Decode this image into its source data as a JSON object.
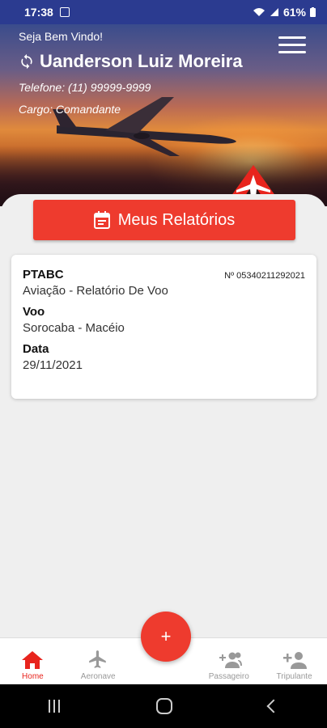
{
  "status_bar": {
    "time": "17:38",
    "battery": "61%"
  },
  "header": {
    "greeting": "Seja Bem Vindo!",
    "user_name": "Uanderson Luiz Moreira",
    "phone": "Telefone: (11) 99999-9999",
    "role": "Cargo: Comandante"
  },
  "reports_button": {
    "label": "Meus Relatórios"
  },
  "report": {
    "aircraft": "PTABC",
    "number": "Nº 05340211292021",
    "type": "Aviação - Relatório De Voo",
    "flight_label": "Voo",
    "flight_route": "Sorocaba - Macéio",
    "date_label": "Data",
    "date_value": "29/11/2021"
  },
  "fab": {
    "label": "+"
  },
  "bottom_nav": {
    "items": [
      {
        "label": "Home",
        "icon": "home-icon",
        "active": true
      },
      {
        "label": "Aeronave",
        "icon": "airplane-icon",
        "active": false
      },
      {
        "label": "Passageiro",
        "icon": "group-add-icon",
        "active": false
      },
      {
        "label": "Tripulante",
        "icon": "person-add-icon",
        "active": false
      }
    ]
  },
  "colors": {
    "primary": "#ee3b2e",
    "status_bar": "#2b3b90",
    "active_nav": "#e8241d",
    "inactive_nav": "#999999"
  }
}
